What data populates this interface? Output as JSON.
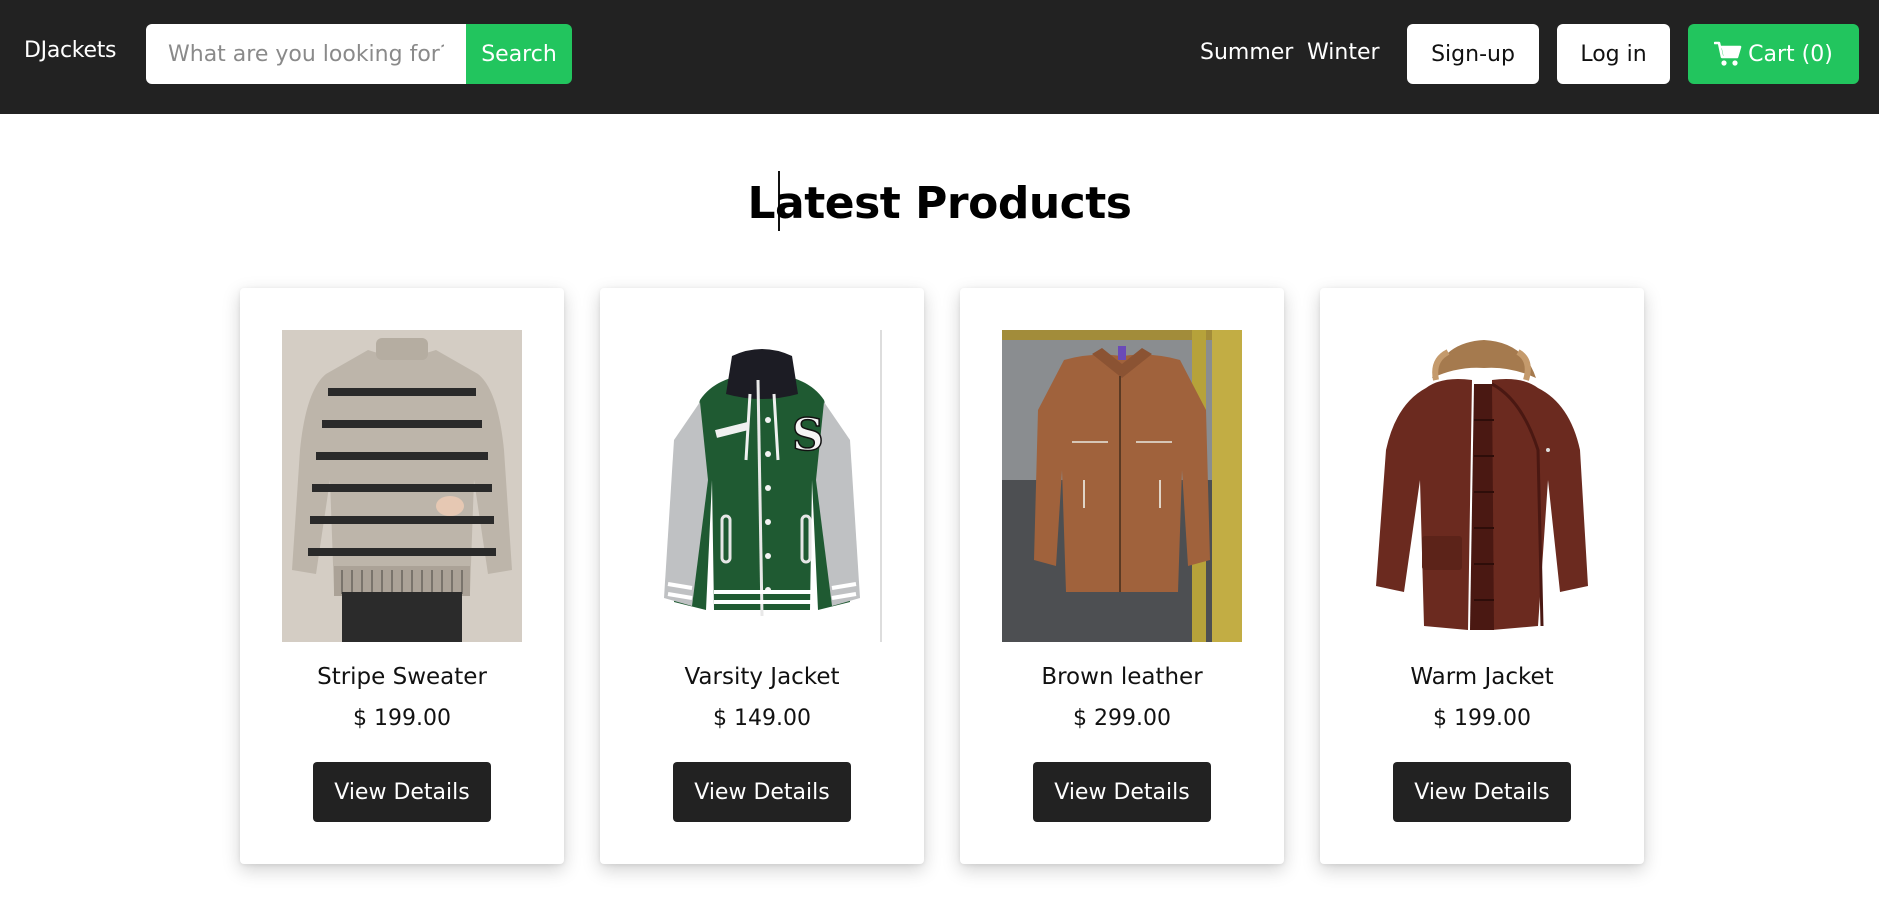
{
  "navbar": {
    "brand": "DJackets",
    "search": {
      "placeholder": "What are you looking for?",
      "value": "",
      "button_label": "Search"
    },
    "links": [
      {
        "label": "Summer"
      },
      {
        "label": "Winter"
      }
    ],
    "signup_label": "Sign-up",
    "login_label": "Log in",
    "cart_label": "Cart (0)",
    "cart_icon": "shopping-cart-icon"
  },
  "main": {
    "title": "Latest Products",
    "products": [
      {
        "name": "Stripe Sweater",
        "price": "$ 199.00",
        "button_label": "View Details",
        "image": "striped-sweater-photo"
      },
      {
        "name": "Varsity Jacket",
        "price": "$ 149.00",
        "button_label": "View Details",
        "image": "varsity-jacket-photo"
      },
      {
        "name": "Brown leather",
        "price": "$ 299.00",
        "button_label": "View Details",
        "image": "brown-leather-jacket-photo"
      },
      {
        "name": "Warm Jacket",
        "price": "$ 199.00",
        "button_label": "View Details",
        "image": "warm-parka-jacket-photo"
      }
    ]
  },
  "colors": {
    "navbar": "#222222",
    "accent": "#22c55e",
    "dark_button": "#222222"
  }
}
